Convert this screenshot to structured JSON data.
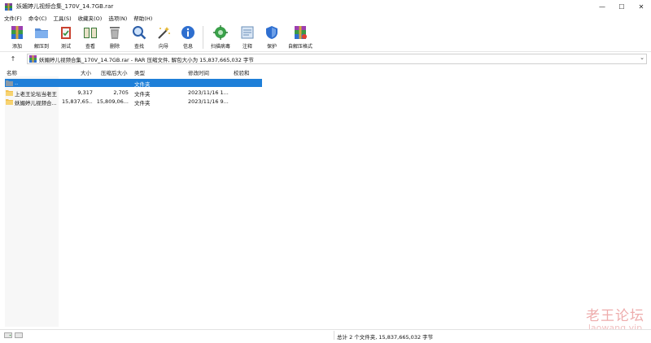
{
  "window": {
    "title": "妖媚婷儿视频合集_170V_14.7GB.rar",
    "minimize": "—",
    "maximize": "☐",
    "close": "✕"
  },
  "menu": [
    "文件(F)",
    "命令(C)",
    "工具(S)",
    "收藏夹(O)",
    "选项(N)",
    "帮助(H)"
  ],
  "toolbar": {
    "add": "添加",
    "extract_to": "解压到",
    "test": "测试",
    "view": "查看",
    "delete": "删除",
    "find": "查找",
    "wizard": "向导",
    "info": "信息",
    "virus_scan": "扫描病毒",
    "comment": "注释",
    "protect": "保护",
    "sfx": "自解压格式"
  },
  "address": {
    "up_arrow": "↑",
    "text": "妖媚婷儿视频合集_170V_14.7GB.rar - RAR 压缩文件, 解包大小为 15,837,665,032 字节",
    "dropdown": "⌄"
  },
  "columns": {
    "name": "名称",
    "size": "大小",
    "packed": "压缩后大小",
    "type": "类型",
    "modified": "修改时间",
    "crc": "校验和"
  },
  "rows": [
    {
      "name": "..",
      "size": "",
      "packed": "",
      "type": "文件夹",
      "modified": "",
      "crc": ""
    },
    {
      "name": "上老王论坛当老王",
      "size": "9,317",
      "packed": "2,705",
      "type": "文件夹",
      "modified": "2023/11/16 1...",
      "crc": ""
    },
    {
      "name": "妖媚婷儿视频合...",
      "size": "15,837,65...",
      "packed": "15,809,06...",
      "type": "文件夹",
      "modified": "2023/11/16 9...",
      "crc": ""
    }
  ],
  "status": {
    "summary": "总计 2 个文件夹, 15,837,665,032 字节"
  },
  "watermark": {
    "cn": "老王论坛",
    "en": "laowang.vip"
  },
  "colors": {
    "selection": "#1e7fd8",
    "folder": "#f2c14e"
  }
}
